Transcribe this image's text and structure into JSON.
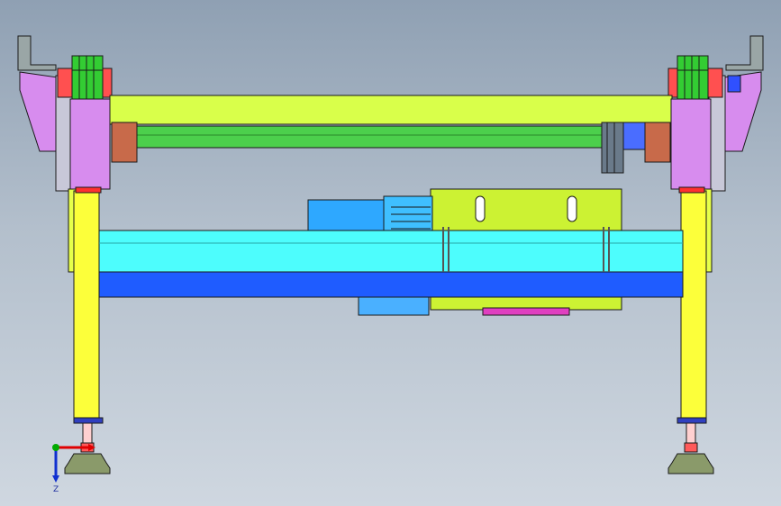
{
  "viewport": {
    "background_top": "#8fa0b3",
    "background_bottom": "#cfd7e0"
  },
  "colors": {
    "leg": "#fcff3a",
    "upper_beam": "#d9ff4a",
    "shaft": "#4ccf4c",
    "cross_beam": "#4dfdfd",
    "lower_beam": "#1f5cff",
    "bracket": "#d78cee",
    "gear": "#33cc33",
    "motor": "#2ea8ff",
    "gearbox": "#ccf233",
    "coupling": "#c86a4a",
    "foot_pad": "#8a9a6a",
    "adjuster": "#ff5a5a",
    "outline": "#1a1a1a"
  },
  "triad": {
    "axis_x": "#e00000",
    "axis_y": "#00aa00",
    "axis_z": "#1030d0",
    "z_label": "Z"
  }
}
